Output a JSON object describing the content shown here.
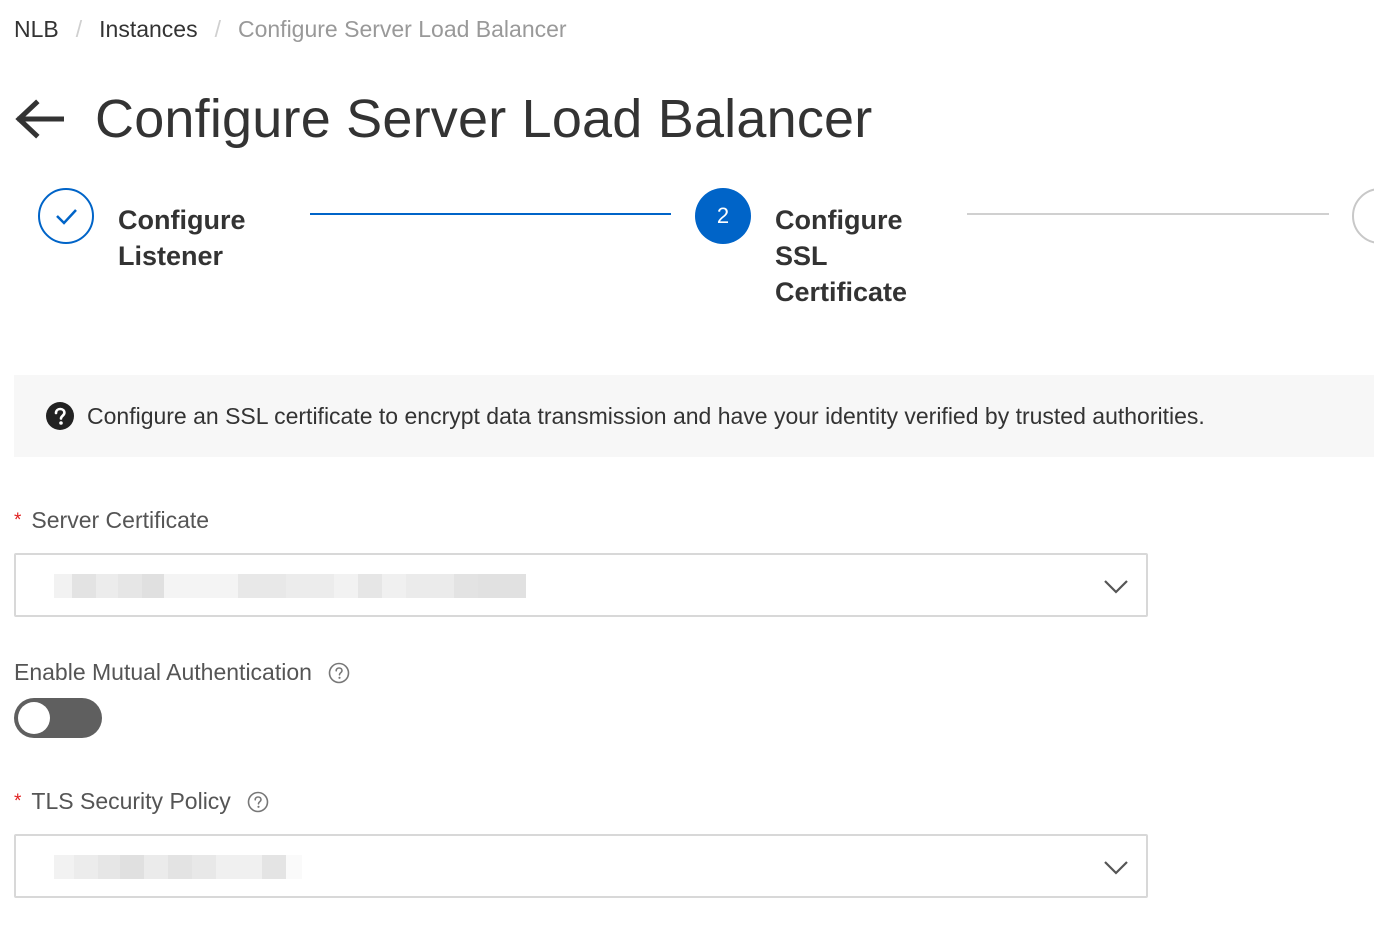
{
  "breadcrumb": {
    "items": [
      "NLB",
      "Instances",
      "Configure Server Load Balancer"
    ],
    "separator": "/"
  },
  "header": {
    "title": "Configure Server Load Balancer",
    "back_icon": "arrow-left-icon"
  },
  "steps": {
    "items": [
      {
        "label": "Configure Listener",
        "status": "done"
      },
      {
        "label": "Configure SSL Certificate",
        "status": "active",
        "number": "2"
      },
      {
        "label": "",
        "status": "pending"
      }
    ],
    "label_lines": {
      "step1": [
        "Configure",
        "Listener"
      ],
      "step2": [
        "Configure",
        "SSL",
        "Certificate"
      ]
    }
  },
  "notice": {
    "icon": "question-circle-icon",
    "text": "Configure an SSL certificate to encrypt data transmission and have your identity verified by trusted authorities."
  },
  "form": {
    "server_certificate": {
      "label": "Server Certificate",
      "required": true,
      "value": "(redacted)"
    },
    "mutual_auth": {
      "label": "Enable Mutual Authentication",
      "enabled": false
    },
    "tls_policy": {
      "label": "TLS Security Policy",
      "required": true,
      "value": "(redacted)"
    }
  },
  "colors": {
    "primary": "#0064c8",
    "required": "#e02020",
    "toggle_off": "#5f5f5f",
    "notice_bg": "#f7f7f7"
  }
}
